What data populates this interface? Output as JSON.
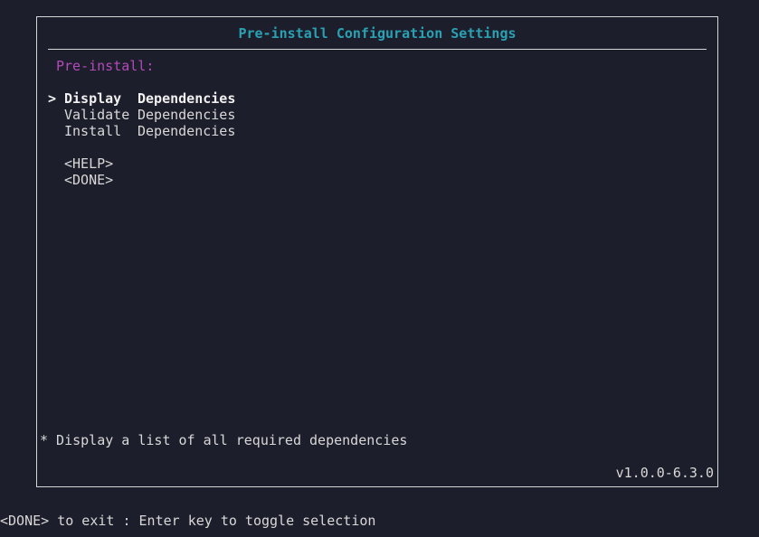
{
  "dialog": {
    "title": "Pre-install Configuration Settings",
    "section_label": "Pre-install:",
    "cursor_glyph": ">",
    "items": [
      {
        "label_a": "Display",
        "label_b": "Dependencies",
        "selected": true
      },
      {
        "label_a": "Validate",
        "label_b": "Dependencies",
        "selected": false
      },
      {
        "label_a": "Install",
        "label_b": "Dependencies",
        "selected": false
      }
    ],
    "buttons": {
      "help": "<HELP>",
      "done": "<DONE>"
    },
    "description": "* Display a list of all required dependencies",
    "version": "v1.0.0-6.3.0"
  },
  "footer": {
    "hint": "<DONE> to exit : Enter key to toggle selection"
  },
  "colors": {
    "background": "#1d1e2b",
    "title": "#2aa1b3",
    "section": "#b34ab8",
    "text": "#d8d8d8",
    "border": "#d6d6d6"
  }
}
